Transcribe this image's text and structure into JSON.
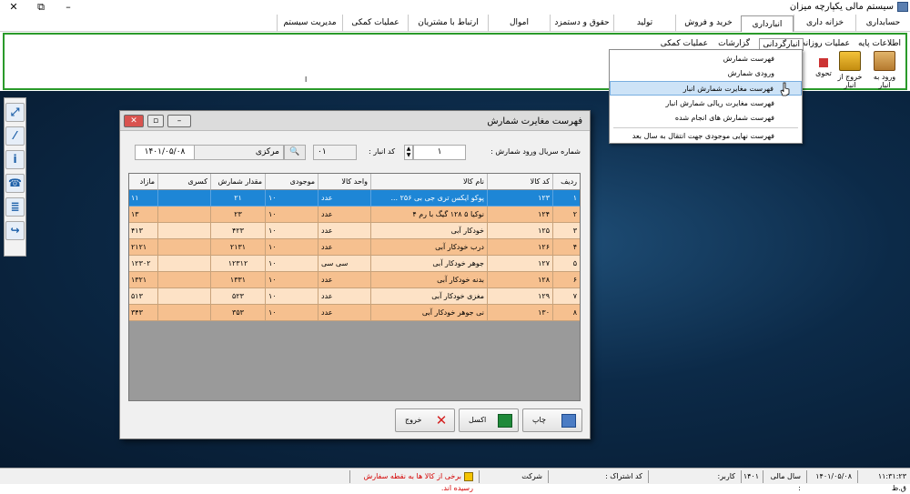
{
  "window": {
    "title": "سیستم مالی یکپارچه میزان",
    "minimize": "–",
    "restore": "⧉",
    "close": "✕"
  },
  "menu": [
    "حسابداری",
    "خزانه داری",
    "انبارداری",
    "خرید و فروش",
    "تولید",
    "حقوق و دستمزد",
    "اموال",
    "ارتباط با مشتریان",
    "عملیات کمکی",
    "مدیریت سیستم"
  ],
  "menu_active_index": 2,
  "ribbon": {
    "tabs": [
      "اطلاعات پایه",
      "عملیات روزانه",
      "انبارگردانی",
      "گزارشات",
      "عملیات کمکی"
    ],
    "active_tab_index": 2,
    "buttons": [
      "ورود به انبار",
      "خروج از انبار",
      "تحوی"
    ],
    "extra_text": "ا"
  },
  "dropdown": {
    "items": [
      "فهرست شمارش",
      "ورودی شمارش",
      "فهرست مغایرت شمارش انبار",
      "فهرست مغایرت ریالی شمارش انبار",
      "فهرست شمارش های انجام شده",
      "فهرست نهایی موجودی جهت انتقال به سال بعد"
    ],
    "highlight_index": 2
  },
  "dialog": {
    "title": "فهرست مغایرت شمارش",
    "filter": {
      "serial_label": "شماره سریال ورود شمارش :",
      "serial_value": "۱",
      "warehouse_label": "کد انبار :",
      "warehouse_code": "۰۱",
      "warehouse_name": "مرکزی",
      "date": "۱۴۰۱/۰۵/۰۸"
    },
    "columns": [
      "ردیف",
      "کد کالا",
      "نام کالا",
      "واحد کالا",
      "موجودی",
      "مقدار شمارش",
      "کسری",
      "مازاد"
    ],
    "rows": [
      [
        "۱",
        "۱۲۳",
        "پوکو ایکس تری جی بی ۲۵۶ ...",
        "عدد",
        "۱۰",
        "۲۱",
        "",
        "۱۱"
      ],
      [
        "۲",
        "۱۲۴",
        "نوکیا ۵ ۱۲۸ گیگ با رم ۴",
        "عدد",
        "۱۰",
        "۲۳",
        "",
        "۱۳"
      ],
      [
        "۳",
        "۱۲۵",
        "خودکار آبی",
        "عدد",
        "۱۰",
        "۴۲۳",
        "",
        "۴۱۳"
      ],
      [
        "۴",
        "۱۲۶",
        "درب خودکار آبی",
        "عدد",
        "۱۰",
        "۲۱۳۱",
        "",
        "۲۱۲۱"
      ],
      [
        "۵",
        "۱۲۷",
        "جوهر خودکار آبی",
        "سی سی",
        "۱۰",
        "۱۲۳۱۲",
        "",
        "۱۲۳۰۲"
      ],
      [
        "۶",
        "۱۲۸",
        "بدنه خودکار آبی",
        "عدد",
        "۱۰",
        "۱۳۳۱",
        "",
        "۱۳۲۱"
      ],
      [
        "۷",
        "۱۲۹",
        "مغزی خودکار آبی",
        "عدد",
        "۱۰",
        "۵۲۳",
        "",
        "۵۱۳"
      ],
      [
        "۸",
        "۱۳۰",
        "نی جوهر خودکار آبی",
        "عدد",
        "۱۰",
        "۳۵۳",
        "",
        "۳۴۳"
      ]
    ],
    "selected_row": 0,
    "buttons": {
      "print": "چاپ",
      "excel": "اکسل",
      "exit": "خروج"
    }
  },
  "status": {
    "time": "۱۱:۳۱:۲۳ ق.ظ",
    "date": "۱۴۰۱/۰۵/۰۸",
    "fiscal_year_label": "سال مالی :",
    "fiscal_year": "۱۴۰۱",
    "user_label": "کاربر:",
    "sub_code_label": "کد اشتراک :",
    "company_label": "شرکت",
    "warning": "برخی از کالا ها به نقطه سفارش رسیده اند."
  },
  "colors": {
    "ribbon_border": "#2a9a2a",
    "row_selected": "#1e86d6",
    "row_odd": "#f6c08f",
    "row_even": "#fde2c6",
    "warning": "#d40000"
  }
}
